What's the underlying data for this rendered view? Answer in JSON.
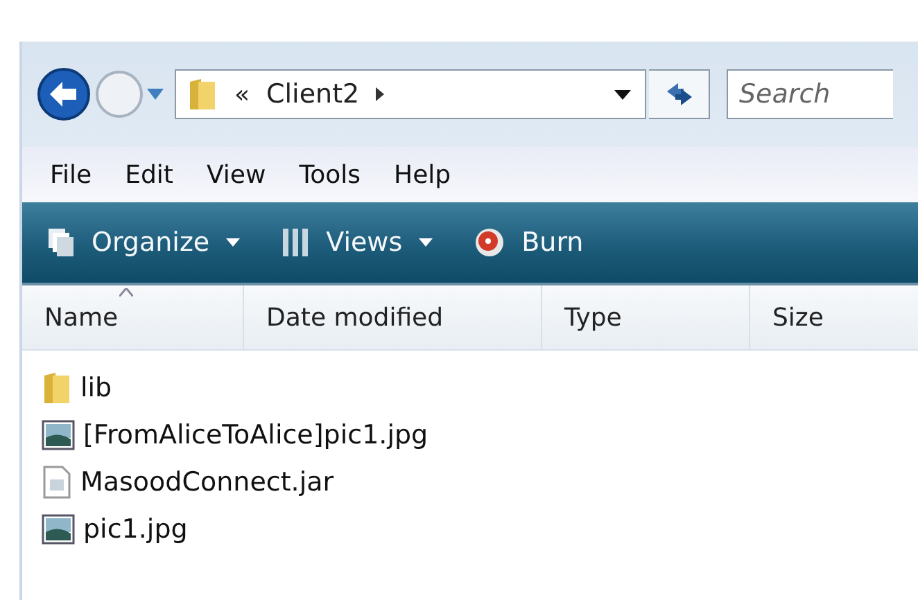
{
  "address_bar": {
    "overflow": "«",
    "path": "Client2",
    "search_placeholder": "Search"
  },
  "menu": [
    "File",
    "Edit",
    "View",
    "Tools",
    "Help"
  ],
  "toolbar": [
    {
      "label": "Organize",
      "kind": "organize",
      "dropdown": true
    },
    {
      "label": "Views",
      "kind": "views",
      "dropdown": true
    },
    {
      "label": "Burn",
      "kind": "burn",
      "dropdown": false
    }
  ],
  "columns": [
    {
      "label": "Name",
      "sorted": true
    },
    {
      "label": "Date modified",
      "sorted": false
    },
    {
      "label": "Type",
      "sorted": false
    },
    {
      "label": "Size",
      "sorted": false
    }
  ],
  "files": [
    {
      "name": "lib",
      "kind": "folder"
    },
    {
      "name": "[FromAliceToAlice]pic1.jpg",
      "kind": "image"
    },
    {
      "name": "MasoodConnect.jar",
      "kind": "jar"
    },
    {
      "name": "pic1.jpg",
      "kind": "image"
    }
  ]
}
